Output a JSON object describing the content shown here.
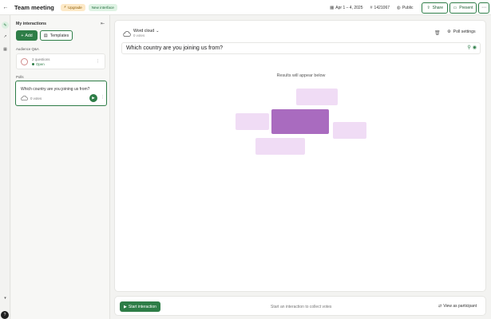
{
  "header": {
    "title": "Team meeting",
    "upgrade_label": "Upgrade",
    "new_interface_label": "New interface",
    "date_range": "Apr 1 – 4, 2025",
    "code": "1421067",
    "visibility": "Public",
    "share_label": "Share",
    "present_label": "Present"
  },
  "panel": {
    "title": "My interactions",
    "add_label": "Add",
    "templates_label": "Templates",
    "qa_section": "Audience Q&A",
    "qa_count": "2 questions",
    "qa_status": "Open",
    "polls_section": "Polls",
    "poll_question": "Which country are you joining us from?",
    "poll_votes": "0 votes"
  },
  "slide": {
    "type_label": "Word cloud",
    "votes": "0 votes",
    "settings_label": "Poll settings",
    "question": "Which country are you joining us from?",
    "results_hint": "Results will appear below"
  },
  "bottom": {
    "start_label": "Start interaction",
    "hint": "Start an interaction to collect votes",
    "view_participant_label": "View as participant"
  },
  "colors": {
    "accent": "#2e7d47",
    "blob_dark": "#a96bbf",
    "blob_light": "#f0dcf5"
  },
  "icons": {
    "back": "arrow-left-icon",
    "upgrade": "lightning-icon",
    "calendar": "calendar-icon",
    "hash": "hash-icon",
    "globe": "globe-icon",
    "share": "share-icon",
    "present": "present-icon",
    "more": "more-icon",
    "collapse": "collapse-icon",
    "trash": "trash-icon",
    "gear": "gear-icon",
    "play": "play-icon",
    "help": "help-icon"
  }
}
